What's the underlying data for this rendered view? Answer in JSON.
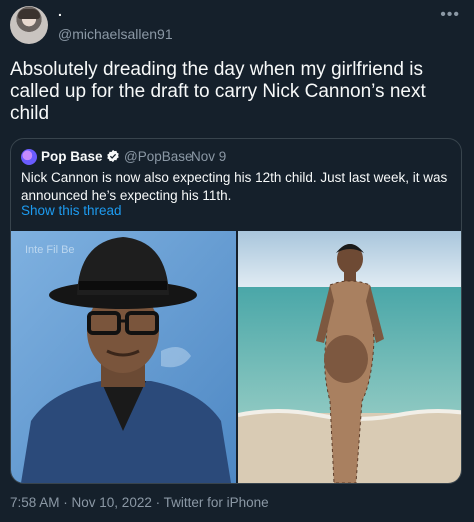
{
  "author": {
    "display_name": ".",
    "handle": "@michaelsallen91"
  },
  "menu_icon": "more-horizontal-icon",
  "tweet": {
    "text": "Absolutely dreading the day when my girlfriend is called up for the draft to carry Nick Cannon’s next child"
  },
  "quoted": {
    "name": "Pop Base",
    "handle": "@PopBase",
    "separator": "·",
    "date": "Nov 9",
    "text": "Nick Cannon is now also expecting his 12th child. Just last week, it was announced he’s expecting his 11th.",
    "show_thread": "Show this thread",
    "verified_icon": "verified-badge-icon",
    "backdrop_text": "Inte Fil Be"
  },
  "meta": {
    "time": "7:58 AM",
    "sep1": " · ",
    "date": "Nov 10, 2022",
    "sep2": " · ",
    "source": "Twitter for iPhone"
  },
  "colors": {
    "background": "#15202b",
    "link": "#1d9bf0",
    "muted": "#8b98a5",
    "border": "#38444d"
  }
}
